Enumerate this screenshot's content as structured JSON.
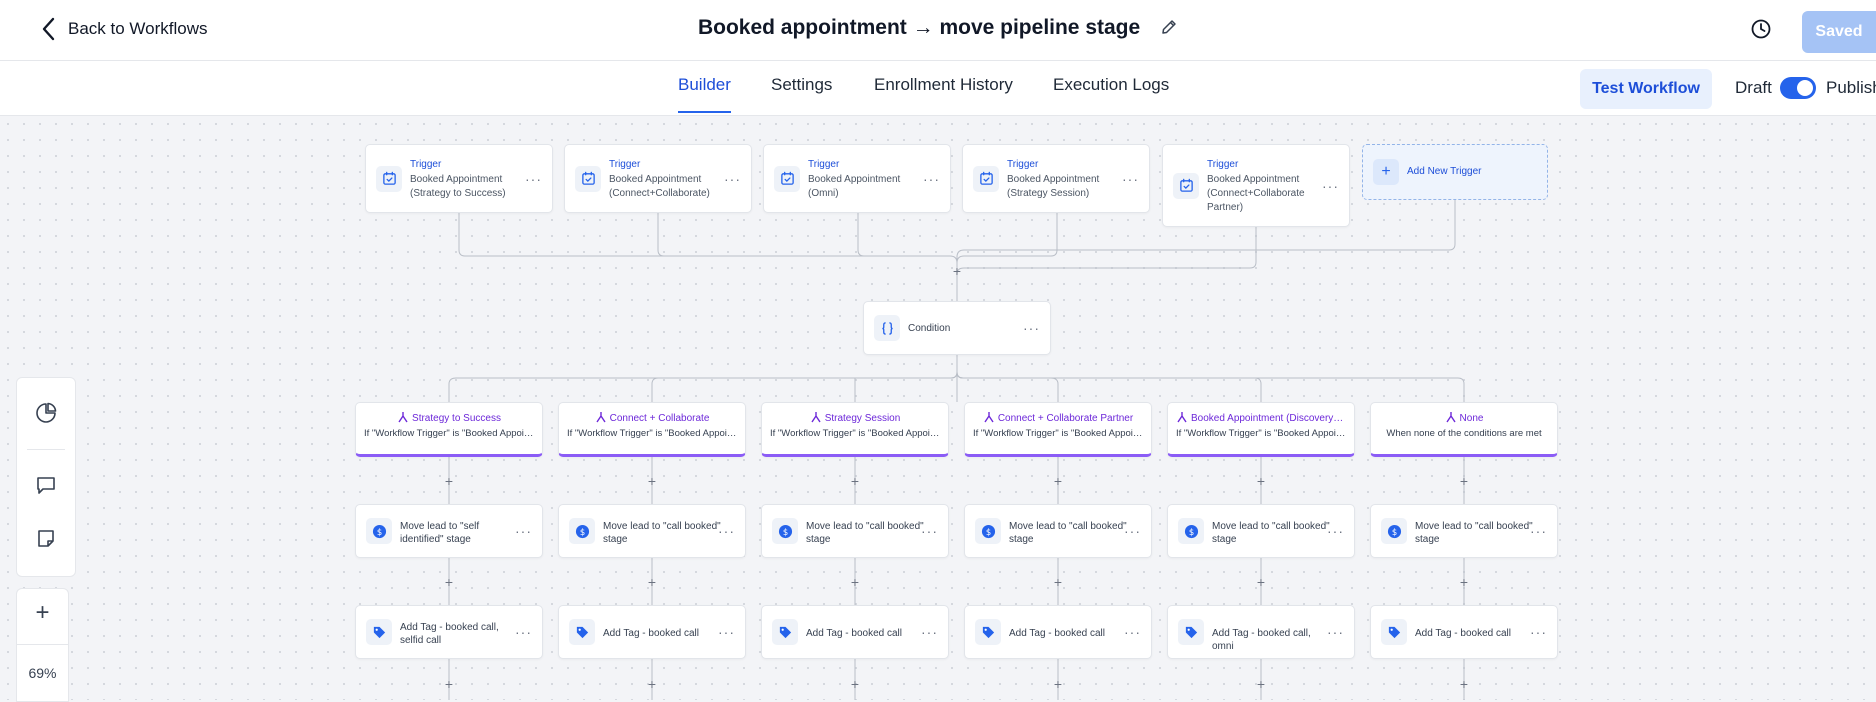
{
  "header": {
    "back_label": "Back to Workflows",
    "title": "Booked appointment → move pipeline stage",
    "saved_label": "Saved"
  },
  "tabs": [
    {
      "label": "Builder",
      "active": true
    },
    {
      "label": "Settings"
    },
    {
      "label": "Enrollment History"
    },
    {
      "label": "Execution Logs"
    }
  ],
  "toolbar": {
    "test_label": "Test Workflow",
    "draft_label": "Draft",
    "publish_label": "Publish",
    "published": true
  },
  "triggers": [
    {
      "label": "Trigger",
      "sub": "Booked Appointment (Strategy to Success)"
    },
    {
      "label": "Trigger",
      "sub": "Booked Appointment (Connect+Collaborate)"
    },
    {
      "label": "Trigger",
      "sub": "Booked Appointment (Omni)"
    },
    {
      "label": "Trigger",
      "sub": "Booked Appointment (Strategy Session)"
    },
    {
      "label": "Trigger",
      "sub": "Booked Appointment (Connect+Collaborate Partner)"
    }
  ],
  "add_trigger_label": "Add New Trigger",
  "condition_label": "Condition",
  "branches": [
    {
      "title": "Strategy to Success",
      "subtitle": "If \"Workflow Trigger\" is \"Booked Appointment (Strategy to Success)\"",
      "action1": "Move lead to \"self identified\" stage",
      "action2": "Add Tag - booked call, selfid call"
    },
    {
      "title": "Connect + Collaborate",
      "subtitle": "If \"Workflow Trigger\" is \"Booked Appointment (Connect+Collaborate)\"",
      "action1": "Move lead to \"call booked\" stage",
      "action2": "Add Tag - booked call"
    },
    {
      "title": "Strategy Session",
      "subtitle": "If \"Workflow Trigger\" is \"Booked Appointment (Strategy Session)\"",
      "action1": "Move lead to \"call booked\" stage",
      "action2": "Add Tag - booked call"
    },
    {
      "title": "Connect + Collaborate Partner",
      "subtitle": "If \"Workflow Trigger\" is \"Booked Appointment (Connect+Collaborate Partner)\"",
      "action1": "Move lead to \"call booked\" stage",
      "action2": "Add Tag - booked call"
    },
    {
      "title": "Booked Appointment (Discovery Call)",
      "subtitle": "If \"Workflow Trigger\" is \"Booked Appointment (Omni)\"",
      "action1": "Move lead to \"call booked\" stage",
      "action2": "Add Tag - booked call, omni"
    },
    {
      "title": "None",
      "subtitle": "When none of the conditions are met",
      "action1": "Move lead to \"call booked\" stage",
      "action2": "Add Tag - booked call"
    }
  ],
  "zoom": {
    "level": "69%"
  },
  "colors": {
    "accent": "#2563eb",
    "branch": "#8b5cf6",
    "saved": "#a5c3f5"
  }
}
